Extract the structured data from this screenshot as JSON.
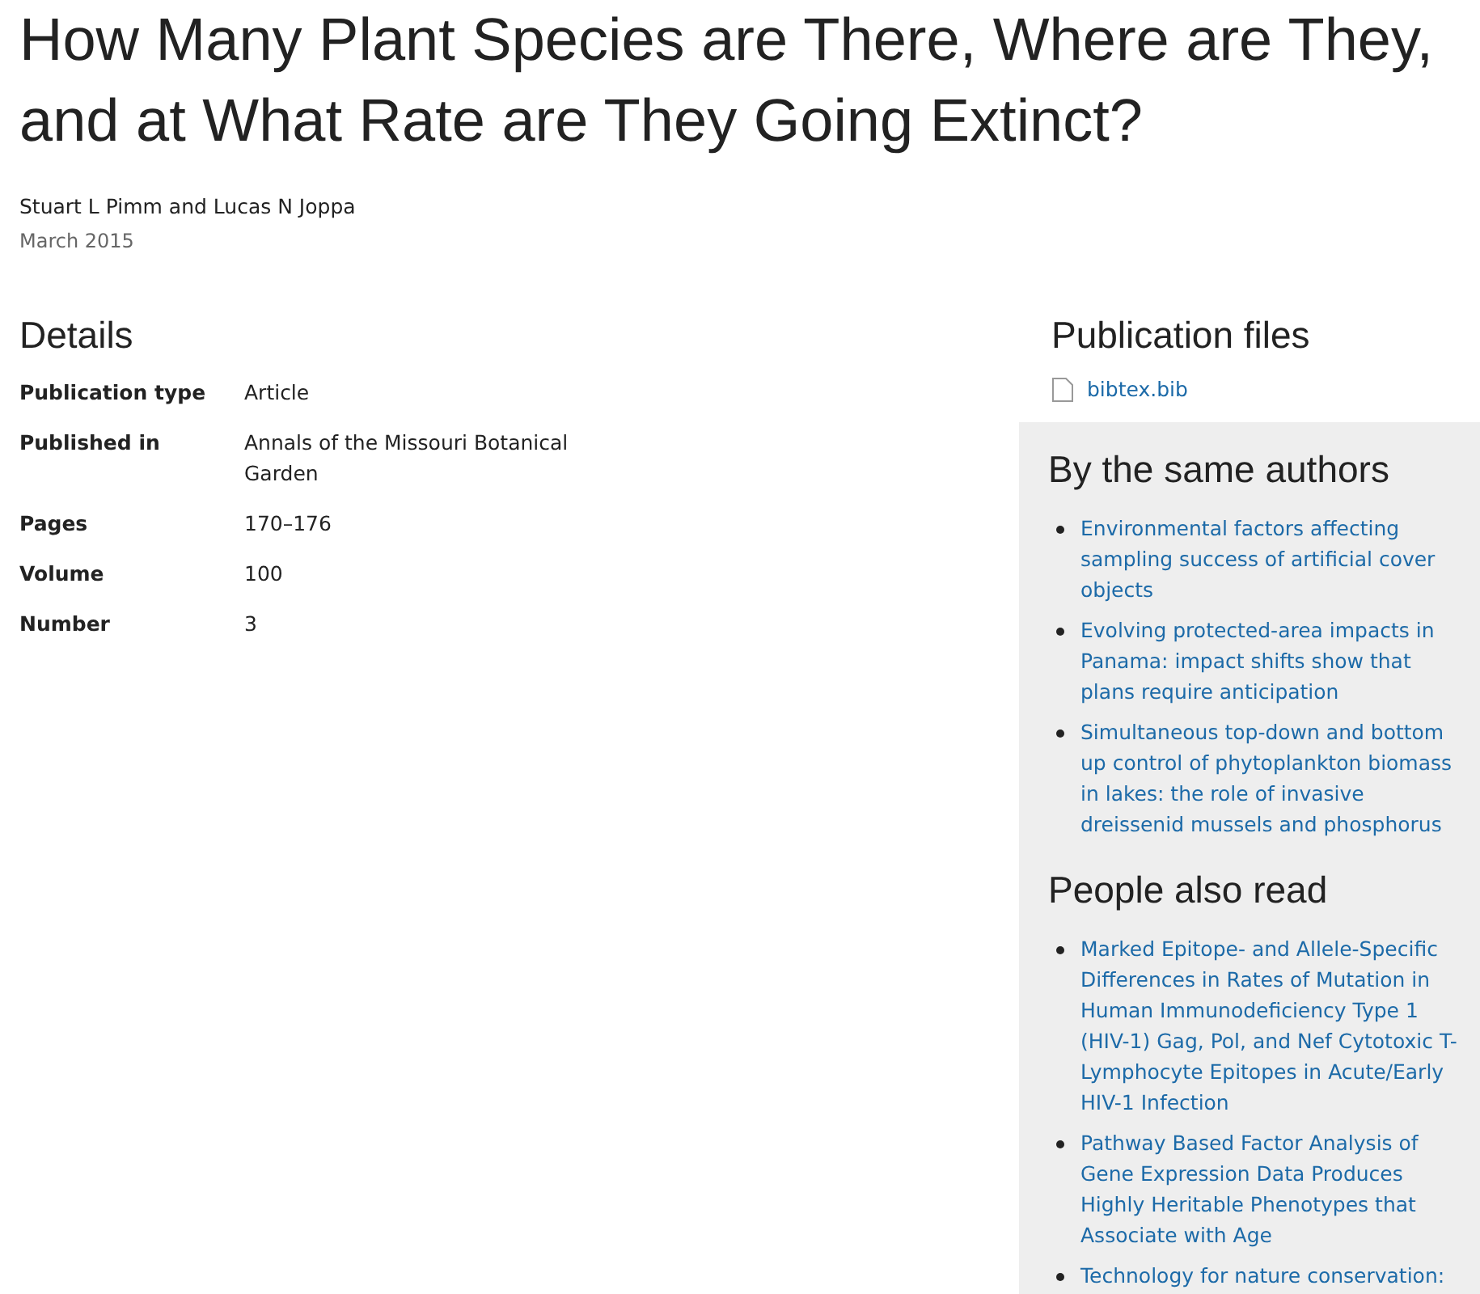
{
  "title": "How Many Plant Species are There, Where are They, and at What Rate are They Going Extinct?",
  "authors": "Stuart L Pimm and Lucas N Joppa",
  "date": "March 2015",
  "details": {
    "heading": "Details",
    "rows": [
      {
        "label": "Publication type",
        "value": "Article"
      },
      {
        "label": "Published in",
        "value": "Annals of the Missouri Botanical Garden"
      },
      {
        "label": "Pages",
        "value": "170–176"
      },
      {
        "label": "Volume",
        "value": "100"
      },
      {
        "label": "Number",
        "value": "3"
      }
    ]
  },
  "publication_files": {
    "heading": "Publication files",
    "files": [
      "bibtex.bib"
    ]
  },
  "same_authors": {
    "heading": "By the same authors",
    "items": [
      "Environmental factors affecting sampling success of artificial cover objects",
      "Evolving protected-area impacts in Panama: impact shifts show that plans require anticipation",
      "Simultaneous top-down and bottom up control of phytoplankton biomass in lakes: the role of invasive dreissenid mussels and phosphorus"
    ]
  },
  "also_read": {
    "heading": "People also read",
    "items": [
      "Marked Epitope- and Allele-Specific Differences in Rates of Mutation in Human Immunodeficiency Type 1 (HIV-1) Gag, Pol, and Nef Cytotoxic T-Lymphocyte Epitopes in Acute/Early HIV-1 Infection",
      "Pathway Based Factor Analysis of Gene Expression Data Produces Highly Heritable Phenotypes that Associate with Age",
      "Technology for nature conservation:"
    ]
  }
}
